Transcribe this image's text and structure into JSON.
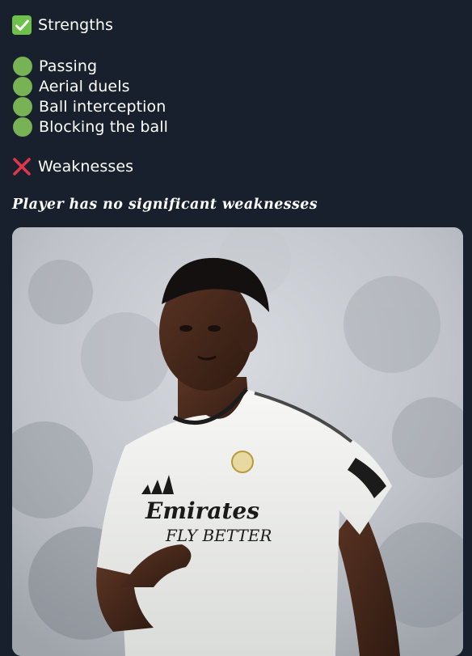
{
  "strengths": {
    "icon": "check-mark-button-icon",
    "title": "Strengths",
    "items": [
      "Passing",
      "Aerial duels",
      "Ball interception",
      "Blocking the ball"
    ]
  },
  "weaknesses": {
    "icon": "cross-mark-icon",
    "title": "Weaknesses",
    "note": "Player has no significant weaknesses"
  },
  "photo": {
    "sponsor_line1": "Emirates",
    "sponsor_line2": "FLY BETTER"
  },
  "colors": {
    "background": "#17202c",
    "check_green": "#6fc04a",
    "dot_green": "#77b255",
    "cross_red": "#e0364a"
  }
}
